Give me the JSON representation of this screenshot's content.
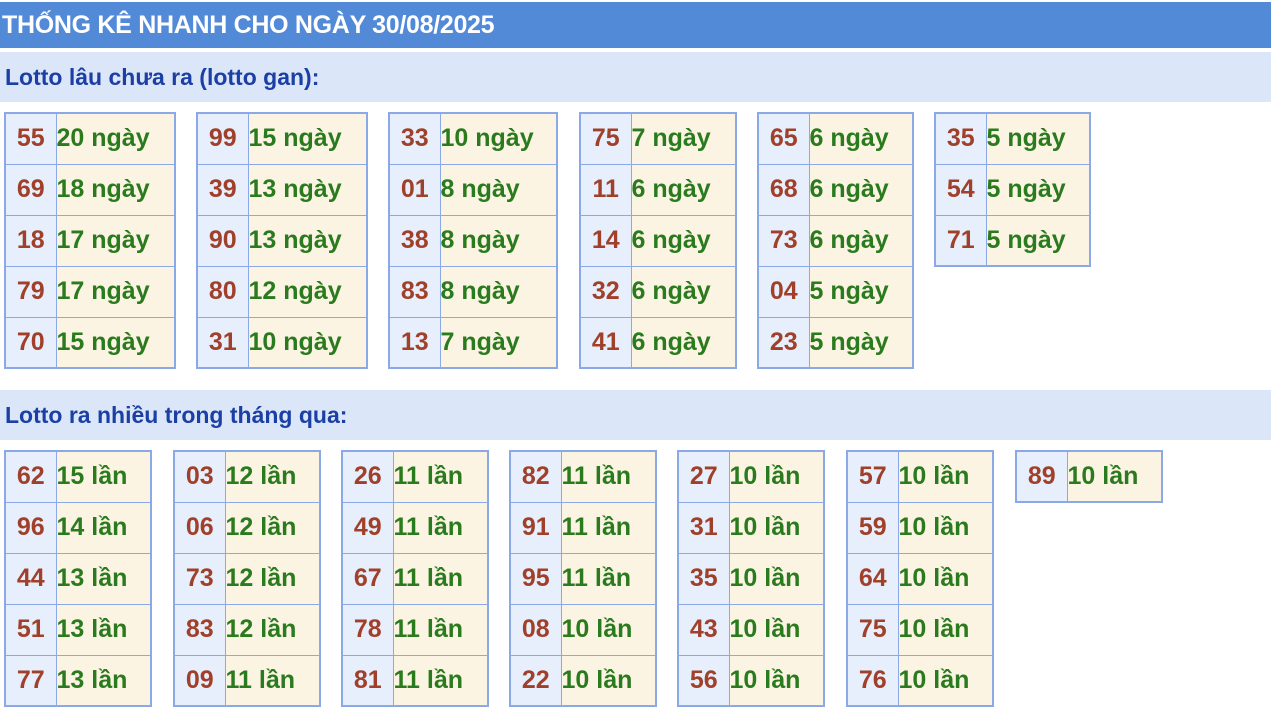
{
  "header": {
    "title": "THỐNG KÊ NHANH CHO NGÀY 30/08/2025"
  },
  "section1": {
    "title": "Lotto lâu chưa ra (lotto gan):",
    "columns": [
      [
        {
          "num": "55",
          "val": "20 ngày"
        },
        {
          "num": "69",
          "val": "18 ngày"
        },
        {
          "num": "18",
          "val": "17 ngày"
        },
        {
          "num": "79",
          "val": "17 ngày"
        },
        {
          "num": "70",
          "val": "15 ngày"
        }
      ],
      [
        {
          "num": "99",
          "val": "15 ngày"
        },
        {
          "num": "39",
          "val": "13 ngày"
        },
        {
          "num": "90",
          "val": "13 ngày"
        },
        {
          "num": "80",
          "val": "12 ngày"
        },
        {
          "num": "31",
          "val": "10 ngày"
        }
      ],
      [
        {
          "num": "33",
          "val": "10 ngày"
        },
        {
          "num": "01",
          "val": "8 ngày"
        },
        {
          "num": "38",
          "val": "8 ngày"
        },
        {
          "num": "83",
          "val": "8 ngày"
        },
        {
          "num": "13",
          "val": "7 ngày"
        }
      ],
      [
        {
          "num": "75",
          "val": "7 ngày"
        },
        {
          "num": "11",
          "val": "6 ngày"
        },
        {
          "num": "14",
          "val": "6 ngày"
        },
        {
          "num": "32",
          "val": "6 ngày"
        },
        {
          "num": "41",
          "val": "6 ngày"
        }
      ],
      [
        {
          "num": "65",
          "val": "6 ngày"
        },
        {
          "num": "68",
          "val": "6 ngày"
        },
        {
          "num": "73",
          "val": "6 ngày"
        },
        {
          "num": "04",
          "val": "5 ngày"
        },
        {
          "num": "23",
          "val": "5 ngày"
        }
      ],
      [
        {
          "num": "35",
          "val": "5 ngày"
        },
        {
          "num": "54",
          "val": "5 ngày"
        },
        {
          "num": "71",
          "val": "5 ngày"
        }
      ]
    ]
  },
  "section2": {
    "title": "Lotto ra nhiều trong tháng qua:",
    "columns": [
      [
        {
          "num": "62",
          "val": "15 lần"
        },
        {
          "num": "96",
          "val": "14 lần"
        },
        {
          "num": "44",
          "val": "13 lần"
        },
        {
          "num": "51",
          "val": "13 lần"
        },
        {
          "num": "77",
          "val": "13 lần"
        }
      ],
      [
        {
          "num": "03",
          "val": "12 lần"
        },
        {
          "num": "06",
          "val": "12 lần"
        },
        {
          "num": "73",
          "val": "12 lần"
        },
        {
          "num": "83",
          "val": "12 lần"
        },
        {
          "num": "09",
          "val": "11 lần"
        }
      ],
      [
        {
          "num": "26",
          "val": "11 lần"
        },
        {
          "num": "49",
          "val": "11 lần"
        },
        {
          "num": "67",
          "val": "11 lần"
        },
        {
          "num": "78",
          "val": "11 lần"
        },
        {
          "num": "81",
          "val": "11 lần"
        }
      ],
      [
        {
          "num": "82",
          "val": "11 lần"
        },
        {
          "num": "91",
          "val": "11 lần"
        },
        {
          "num": "95",
          "val": "11 lần"
        },
        {
          "num": "08",
          "val": "10 lần"
        },
        {
          "num": "22",
          "val": "10 lần"
        }
      ],
      [
        {
          "num": "27",
          "val": "10 lần"
        },
        {
          "num": "31",
          "val": "10 lần"
        },
        {
          "num": "35",
          "val": "10 lần"
        },
        {
          "num": "43",
          "val": "10 lần"
        },
        {
          "num": "56",
          "val": "10 lần"
        }
      ],
      [
        {
          "num": "57",
          "val": "10 lần"
        },
        {
          "num": "59",
          "val": "10 lần"
        },
        {
          "num": "64",
          "val": "10 lần"
        },
        {
          "num": "75",
          "val": "10 lần"
        },
        {
          "num": "76",
          "val": "10 lần"
        }
      ],
      [
        {
          "num": "89",
          "val": "10 lần"
        }
      ]
    ]
  },
  "colors": {
    "header_bg": "#528ad8",
    "section_bg": "#dbe7f8",
    "number": "#a0402a",
    "value": "#2a7a1e",
    "border": "#8ba9e6"
  }
}
